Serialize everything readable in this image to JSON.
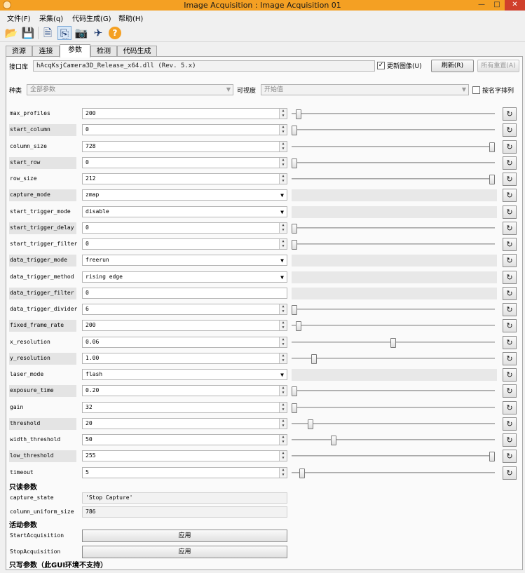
{
  "window": {
    "title": "Image Acquisition : Image Acquisition 01",
    "controls": {
      "minimize": "—",
      "maximize": "□",
      "close": "✕"
    }
  },
  "menu": [
    "文件(F)",
    "采集(q)",
    "代码生成(G)",
    "帮助(H)"
  ],
  "toolbar": {
    "icons": [
      "open-folder-icon",
      "save-icon",
      "document-icon",
      "acquire-icon",
      "camera-icon",
      "shoot-icon",
      "help-icon"
    ],
    "glyphs": [
      "📂",
      "💾",
      "🗎",
      "⎘",
      "📷",
      "✈",
      "?"
    ]
  },
  "tabs": [
    "资源",
    "连接",
    "参数",
    "检测",
    "代码生成"
  ],
  "active_tab": "参数",
  "interface": {
    "label": "接口库",
    "library": "hAcqKsjCamera3D_Release_x64.dll (Rev. 5.x)",
    "update_image_label": "更新图像(U)",
    "update_image_checked": true,
    "refresh_label": "刷新(R)",
    "reset_all_label": "所有重置(A)"
  },
  "filter": {
    "category_label": "种类",
    "category_value": "全部参数",
    "visibility_label": "可视度",
    "visibility_value": "开始值",
    "sort_label": "按名字排列"
  },
  "params": [
    {
      "name": "max_profiles",
      "value": "200",
      "kind": "spin",
      "level": 0.02,
      "shade": false
    },
    {
      "name": "start_column",
      "value": "0",
      "kind": "spin",
      "level": 0.0,
      "shade": true
    },
    {
      "name": "column_size",
      "value": "728",
      "kind": "spin",
      "level": 1.0,
      "shade": false
    },
    {
      "name": "start_row",
      "value": "0",
      "kind": "spin",
      "level": 0.0,
      "shade": true
    },
    {
      "name": "row_size",
      "value": "212",
      "kind": "spin",
      "level": 1.0,
      "shade": false
    },
    {
      "name": "capture_mode",
      "value": "zmap",
      "kind": "select",
      "shade": true
    },
    {
      "name": "start_trigger_mode",
      "value": "disable",
      "kind": "select",
      "shade": false
    },
    {
      "name": "start_trigger_delay",
      "value": "0",
      "kind": "spin",
      "level": 0.0,
      "shade": true
    },
    {
      "name": "start_trigger_filter",
      "value": "0",
      "kind": "spin",
      "level": 0.0,
      "shade": false
    },
    {
      "name": "data_trigger_mode",
      "value": "freerun",
      "kind": "select",
      "shade": true
    },
    {
      "name": "data_trigger_method",
      "value": "rising edge",
      "kind": "select",
      "shade": false
    },
    {
      "name": "data_trigger_filter",
      "value": "0",
      "kind": "text",
      "shade": true
    },
    {
      "name": "data_trigger_divider",
      "value": "6",
      "kind": "spin",
      "level": 0.0,
      "shade": false
    },
    {
      "name": "fixed_frame_rate",
      "value": "200",
      "kind": "spin",
      "level": 0.02,
      "shade": true
    },
    {
      "name": "x_resolution",
      "value": "0.06",
      "kind": "spin",
      "level": 0.5,
      "shade": false
    },
    {
      "name": "y_resolution",
      "value": "1.00",
      "kind": "spin",
      "level": 0.1,
      "shade": true
    },
    {
      "name": "laser_mode",
      "value": "flash",
      "kind": "select",
      "shade": false
    },
    {
      "name": "exposure_time",
      "value": "0.20",
      "kind": "spin",
      "level": 0.0,
      "shade": true
    },
    {
      "name": "gain",
      "value": "32",
      "kind": "spin",
      "level": 0.0,
      "shade": false
    },
    {
      "name": "threshold",
      "value": "20",
      "kind": "spin",
      "level": 0.08,
      "shade": true
    },
    {
      "name": "width_threshold",
      "value": "50",
      "kind": "spin",
      "level": 0.2,
      "shade": false
    },
    {
      "name": "low_threshold",
      "value": "255",
      "kind": "spin",
      "level": 1.0,
      "shade": true
    },
    {
      "name": "timeout",
      "value": "5",
      "kind": "spin",
      "level": 0.04,
      "shade": false
    }
  ],
  "readonly_section": "只读参数",
  "readonly_params": [
    {
      "name": "capture_state",
      "value": "'Stop Capture'"
    },
    {
      "name": "column_uniform_size",
      "value": "786"
    }
  ],
  "action_section": "活动参数",
  "action_params": [
    {
      "name": "StartAcquisition",
      "button": "应用"
    },
    {
      "name": "StopAcquisition",
      "button": "应用"
    }
  ],
  "writeonly_section": "只写参数（此GUI环境不支持）",
  "reset_button_glyph": "↻"
}
